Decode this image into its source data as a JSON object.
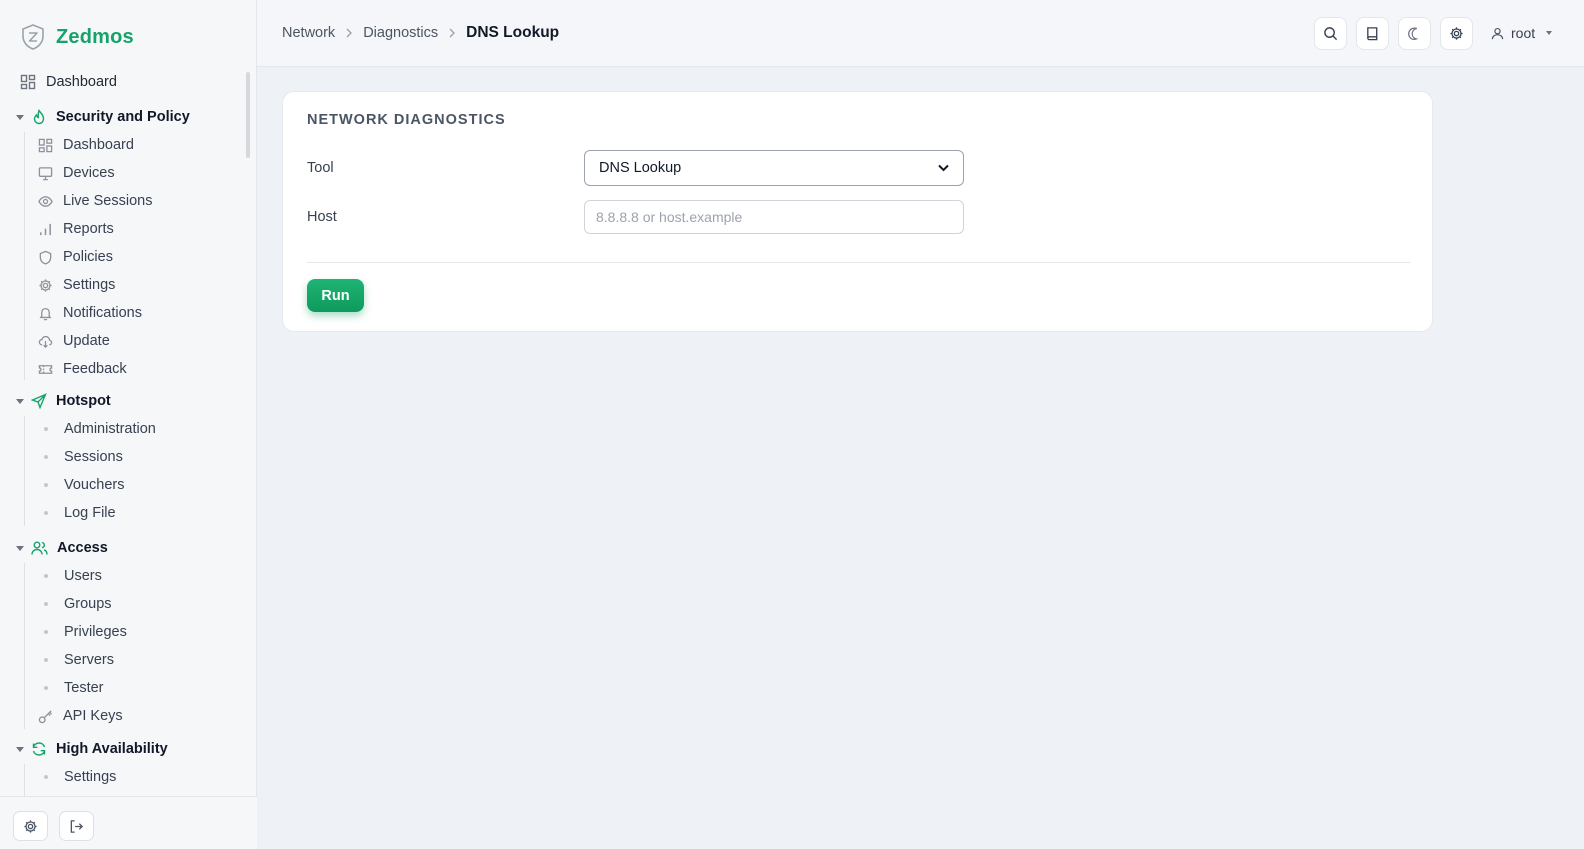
{
  "app": {
    "name": "Zedmos",
    "brand_color": "#16a36a",
    "logo_icon": "shield-z-icon"
  },
  "sidebar": {
    "top_item": {
      "label": "Dashboard",
      "icon": "grid-icon"
    },
    "groups": [
      {
        "label": "Security and Policy",
        "icon": "flame-icon",
        "items": [
          {
            "label": "Dashboard",
            "icon": "grid-icon"
          },
          {
            "label": "Devices",
            "icon": "monitor-icon"
          },
          {
            "label": "Live Sessions",
            "icon": "eye-icon"
          },
          {
            "label": "Reports",
            "icon": "bar-chart-icon"
          },
          {
            "label": "Policies",
            "icon": "shield-icon"
          },
          {
            "label": "Settings",
            "icon": "gear-icon"
          },
          {
            "label": "Notifications",
            "icon": "bell-icon"
          },
          {
            "label": "Update",
            "icon": "cloud-download-icon"
          },
          {
            "label": "Feedback",
            "icon": "ticket-icon"
          }
        ]
      },
      {
        "label": "Hotspot",
        "icon": "send-icon",
        "items": [
          {
            "label": "Administration"
          },
          {
            "label": "Sessions"
          },
          {
            "label": "Vouchers"
          },
          {
            "label": "Log File"
          }
        ]
      },
      {
        "label": "Access",
        "icon": "users-icon",
        "items": [
          {
            "label": "Users"
          },
          {
            "label": "Groups"
          },
          {
            "label": "Privileges"
          },
          {
            "label": "Servers"
          },
          {
            "label": "Tester"
          },
          {
            "label": "API Keys",
            "icon": "key-icon"
          }
        ]
      },
      {
        "label": "High Availability",
        "icon": "refresh-icon",
        "items": [
          {
            "label": "Settings"
          }
        ]
      }
    ],
    "footer": {
      "settings_icon": "gear-icon",
      "logout_icon": "logout-icon"
    }
  },
  "topbar": {
    "breadcrumb": [
      "Network",
      "Diagnostics",
      "DNS Lookup"
    ],
    "actions": [
      "search-icon",
      "book-icon",
      "moon-icon",
      "gear-icon"
    ],
    "user": {
      "name": "root",
      "icon": "user-icon"
    }
  },
  "card": {
    "title": "NETWORK DIAGNOSTICS",
    "tool_label": "Tool",
    "tool_value": "DNS Lookup",
    "host_label": "Host",
    "host_placeholder": "8.8.8.8 or host.example",
    "host_value": "",
    "run_label": "Run"
  }
}
